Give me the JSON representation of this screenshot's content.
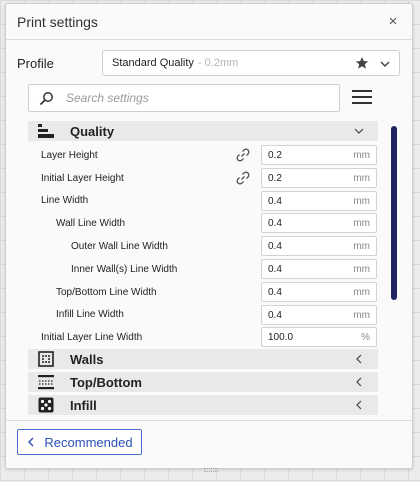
{
  "panel": {
    "title": "Print settings",
    "close_label": "×"
  },
  "profile": {
    "label": "Profile",
    "name": "Standard Quality",
    "sub": "- 0.2mm"
  },
  "search": {
    "placeholder": "Search settings"
  },
  "categories": {
    "quality": {
      "label": "Quality",
      "icon": "quality-icon"
    },
    "walls": {
      "label": "Walls",
      "icon": "walls-icon"
    },
    "topbottom": {
      "label": "Top/Bottom",
      "icon": "top-bottom-icon"
    },
    "infill": {
      "label": "Infill",
      "icon": "infill-icon"
    }
  },
  "settings": [
    {
      "label": "Layer Height",
      "value": "0.2",
      "unit": "mm",
      "linked": true
    },
    {
      "label": "Initial Layer Height",
      "value": "0.2",
      "unit": "mm",
      "linked": true
    },
    {
      "label": "Line Width",
      "value": "0.4",
      "unit": "mm",
      "linked": false
    },
    {
      "label": "Wall Line Width",
      "value": "0.4",
      "unit": "mm",
      "linked": false
    },
    {
      "label": "Outer Wall Line Width",
      "value": "0.4",
      "unit": "mm",
      "linked": false
    },
    {
      "label": "Inner Wall(s) Line Width",
      "value": "0.4",
      "unit": "mm",
      "linked": false
    },
    {
      "label": "Top/Bottom Line Width",
      "value": "0.4",
      "unit": "mm",
      "linked": false
    },
    {
      "label": "Infill Line Width",
      "value": "0.4",
      "unit": "mm",
      "linked": false
    },
    {
      "label": "Initial Layer Line Width",
      "value": "100.0",
      "unit": "%",
      "linked": false
    }
  ],
  "footer": {
    "recommended_label": "Recommended"
  },
  "colors": {
    "accent": "#2b4fb5",
    "scrollbar": "#1d2460"
  }
}
